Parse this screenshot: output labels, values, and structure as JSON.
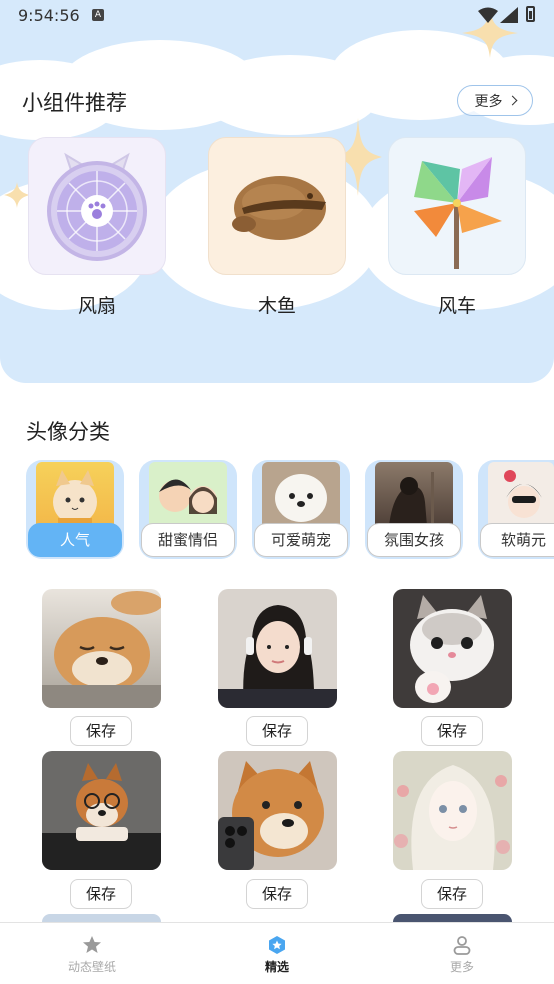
{
  "status_bar": {
    "time": "9:54:56",
    "notification_icon": "A"
  },
  "widgets": {
    "title": "小组件推荐",
    "more_label": "更多",
    "items": [
      {
        "label": "风扇",
        "icon": "fan-icon"
      },
      {
        "label": "木鱼",
        "icon": "wooden-fish-icon"
      },
      {
        "label": "风车",
        "icon": "pinwheel-icon"
      }
    ]
  },
  "avatar_categories": {
    "title": "头像分类",
    "items": [
      {
        "label": "人气",
        "active": true
      },
      {
        "label": "甜蜜情侣",
        "active": false
      },
      {
        "label": "可爱萌宠",
        "active": false
      },
      {
        "label": "氛围女孩",
        "active": false
      },
      {
        "label": "软萌元",
        "active": false
      }
    ]
  },
  "avatar_grid": {
    "save_label": "保存",
    "items": [
      {
        "subject": "shiba-sleeping-with-cat"
      },
      {
        "subject": "girl-with-headphones"
      },
      {
        "subject": "white-kitten-paw"
      },
      {
        "subject": "shiba-with-glasses"
      },
      {
        "subject": "shiba-with-phone"
      },
      {
        "subject": "illustrated-girl"
      }
    ]
  },
  "bottom_nav": {
    "items": [
      {
        "label": "动态壁纸",
        "icon": "star-icon",
        "active": false
      },
      {
        "label": "精选",
        "icon": "featured-icon",
        "active": true
      },
      {
        "label": "更多",
        "icon": "person-icon",
        "active": false
      }
    ]
  },
  "colors": {
    "accent": "#63b4f5",
    "sky": "#d6e9fb"
  }
}
